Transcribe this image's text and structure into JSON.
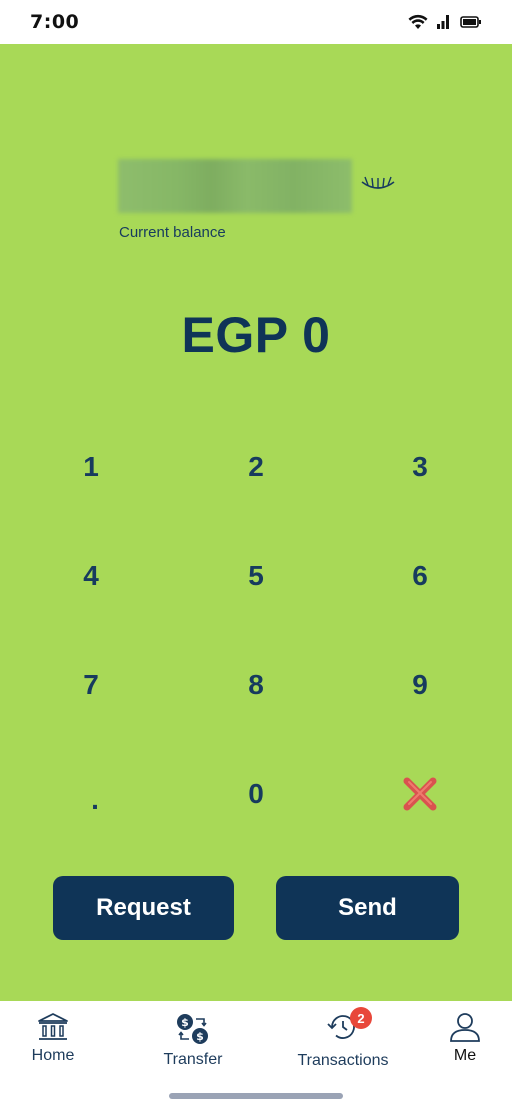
{
  "status_bar": {
    "time": "7:00"
  },
  "balance": {
    "label": "Current balance",
    "toggle_icon": "eye-closed-icon"
  },
  "amount": {
    "currency": "EGP",
    "value": "0",
    "display": "EGP 0"
  },
  "keypad": {
    "keys": [
      "1",
      "2",
      "3",
      "4",
      "5",
      "6",
      "7",
      "8",
      "9",
      ".",
      "0"
    ],
    "delete_icon": "delete-icon"
  },
  "actions": {
    "request_label": "Request",
    "send_label": "Send"
  },
  "colors": {
    "background": "#a8d957",
    "primary": "#0f3457",
    "badge": "#e8473a"
  },
  "tabbar": {
    "items": [
      {
        "label": "Home",
        "icon": "bank-icon"
      },
      {
        "label": "Transfer",
        "icon": "transfer-icon"
      },
      {
        "label": "Transactions",
        "icon": "history-icon",
        "badge": "2"
      },
      {
        "label": "Me",
        "icon": "user-icon"
      }
    ]
  }
}
